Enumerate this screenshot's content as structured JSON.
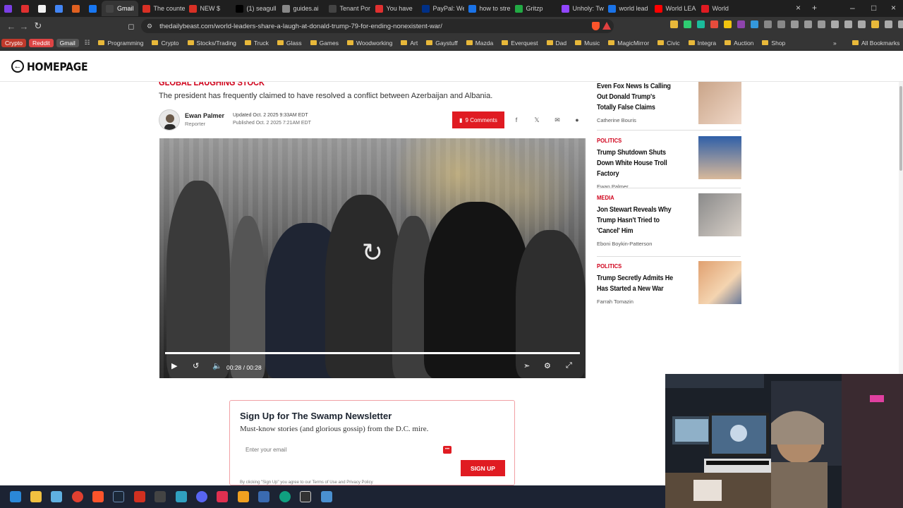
{
  "browser": {
    "tabs": [
      {
        "label": "",
        "color": "#7b3fe4"
      },
      {
        "label": "",
        "color": "#e03030"
      },
      {
        "label": "",
        "color": "#f2f2f2"
      },
      {
        "label": "",
        "color": "#4285f4"
      },
      {
        "label": "",
        "color": "#e06020"
      },
      {
        "label": "",
        "color": "#1877f2"
      },
      {
        "label": "Gmail",
        "color": "#444444",
        "active": true
      },
      {
        "label": "The counte",
        "color": "#d93025"
      },
      {
        "label": "NEW $",
        "color": "#d93025"
      },
      {
        "label": "(1) seagull",
        "color": "#000000"
      },
      {
        "label": "guides.ai",
        "color": "#888888"
      },
      {
        "label": "Tenant Por",
        "color": "#444444"
      },
      {
        "label": "You have",
        "color": "#e03030"
      },
      {
        "label": "PayPal: We",
        "color": "#003087"
      },
      {
        "label": "how to stre",
        "color": "#1a73e8"
      },
      {
        "label": "Gritzp",
        "color": "#22aa44"
      },
      {
        "label": "Unholy: Tw",
        "color": "#9146ff"
      },
      {
        "label": "world lead",
        "color": "#1a73e8"
      },
      {
        "label": "World LEA",
        "color": "#ff0000"
      },
      {
        "label": "World",
        "color": "#e01b22"
      }
    ],
    "url": "thedailybeast.com/world-leaders-share-a-laugh-at-donald-trump-79-for-ending-nonexistent-war/",
    "bookmarks": [
      "Crypto",
      "Reddit",
      "Gmail",
      "Programming",
      "Crypto",
      "Stocks/Trading",
      "Truck",
      "Glass",
      "Games",
      "Woodworking",
      "Art",
      "Gaystuff",
      "Mazda",
      "Everquest",
      "Dad",
      "Music",
      "MagicMirror",
      "Civic",
      "Integra",
      "Auction",
      "Shop"
    ],
    "all_bookmarks": "All Bookmarks"
  },
  "page": {
    "home_label": "HOMEPAGE",
    "kicker": "GLOBAL LAUGHING STOCK",
    "dek": "The president has frequently claimed to have resolved a conflict between Azerbaijan and Albania.",
    "author": {
      "name": "Ewan Palmer",
      "role": "Reporter"
    },
    "updated": "Updated Oct. 2 2025 9:33AM EDT",
    "published": "Published Oct. 2 2025 7:21AM EDT",
    "comments_label": "9 Comments",
    "video": {
      "time_current": "00:28",
      "time_sep": "/",
      "time_total": "00:28",
      "progress": 1.0
    }
  },
  "sidebar": [
    {
      "category": "",
      "title": "Even Fox News Is Calling Out Donald Trump's Totally False Claims",
      "byline": "Catherine Bouris"
    },
    {
      "category": "POLITICS",
      "title": "Trump Shutdown Shuts Down White House Troll Factory",
      "byline": "Ewan Palmer"
    },
    {
      "category": "MEDIA",
      "title": "Jon Stewart Reveals Why Trump Hasn't Tried to 'Cancel' Him",
      "byline": "Eboni Boykin-Patterson"
    },
    {
      "category": "POLITICS",
      "title": "Trump Secretly Admits He Has Started a New War",
      "byline": "Farrah Tomazin"
    }
  ],
  "newsletter": {
    "heading": "Sign Up for The Swamp Newsletter",
    "subheading": "Must-know stories (and glorious gossip) from the D.C. mire.",
    "email_placeholder": "Enter your email",
    "signup_label": "SIGN UP",
    "terms": "By clicking \"Sign Up\" you agree to our Terms of Use and Privacy Policy"
  }
}
